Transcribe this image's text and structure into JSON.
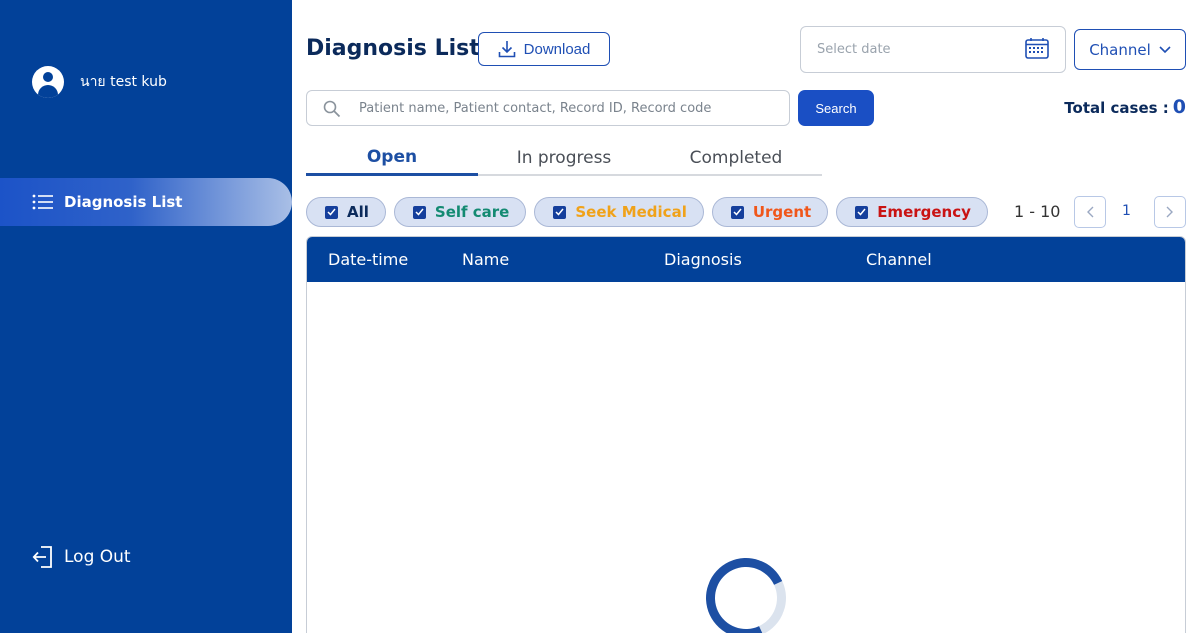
{
  "sidebar": {
    "user_name": "นาย test kub",
    "nav_items": [
      {
        "label": "Diagnosis List",
        "icon": "list-icon"
      }
    ],
    "logout_label": "Log Out"
  },
  "header": {
    "title": "Diagnosis List",
    "download_label": "Download",
    "date_placeholder": "Select date",
    "channel_label": "Channel"
  },
  "search": {
    "placeholder": "Patient name, Patient contact, Record ID, Record code",
    "button_label": "Search"
  },
  "total": {
    "label": "Total cases :",
    "count": "0"
  },
  "tabs": [
    {
      "label": "Open",
      "active": true
    },
    {
      "label": "In progress",
      "active": false
    },
    {
      "label": "Completed",
      "active": false
    }
  ],
  "filters": [
    {
      "label": "All",
      "checked": true,
      "color": "#0b2a5b"
    },
    {
      "label": "Self care",
      "checked": true,
      "color": "#138a72"
    },
    {
      "label": "Seek Medical",
      "checked": true,
      "color": "#f0a21a"
    },
    {
      "label": "Urgent",
      "checked": true,
      "color": "#f0561a"
    },
    {
      "label": "Emergency",
      "checked": true,
      "color": "#c91313"
    }
  ],
  "pagination": {
    "range": "1 - 10",
    "page": "1"
  },
  "table": {
    "columns": [
      "Date-time",
      "Name",
      "Diagnosis",
      "Channel"
    ]
  },
  "colors": {
    "sidebar": "#024199",
    "accent": "#1f4fb4"
  }
}
